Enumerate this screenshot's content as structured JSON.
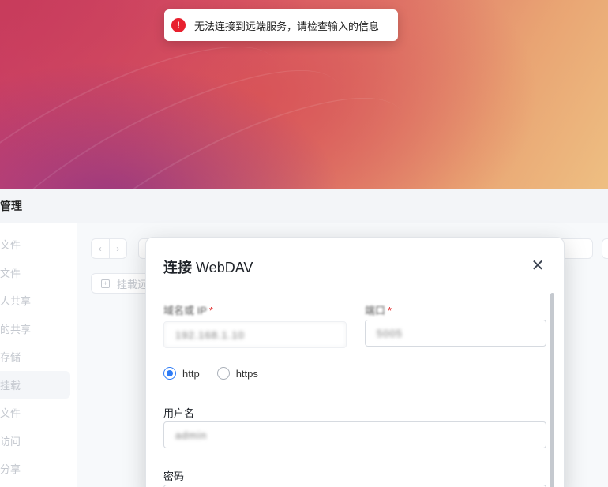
{
  "toast": {
    "icon": "error-icon",
    "message": "无法连接到远端服务，请检查输入的信息"
  },
  "app": {
    "title_fragment": "管理"
  },
  "sidebar": {
    "items": [
      {
        "label": "文件"
      },
      {
        "label": "文件"
      },
      {
        "label": "人共享"
      },
      {
        "label": "的共享"
      },
      {
        "label": "存储"
      },
      {
        "label": "挂载",
        "active": true
      },
      {
        "label": "文件"
      },
      {
        "label": "访问"
      },
      {
        "label": "分享"
      }
    ]
  },
  "toolbar": {
    "back_icon": "chevron-left-icon",
    "forward_icon": "chevron-right-icon",
    "mount_button_label": "挂载远"
  },
  "dialog": {
    "title_prefix": "连接",
    "title_name": "WebDAV",
    "close_icon": "close-icon",
    "host_label": "域名或 IP",
    "host_required": "*",
    "host_value": "192.168.1.10",
    "port_label": "端口",
    "port_required": "*",
    "port_value": "5005",
    "protocol_options": [
      {
        "label": "http",
        "checked": true
      },
      {
        "label": "https",
        "checked": false
      }
    ],
    "username_label": "用户名",
    "username_value": "admin",
    "password_label": "密码"
  },
  "colors": {
    "accent": "#2e7cf6",
    "error": "#e8202e"
  }
}
